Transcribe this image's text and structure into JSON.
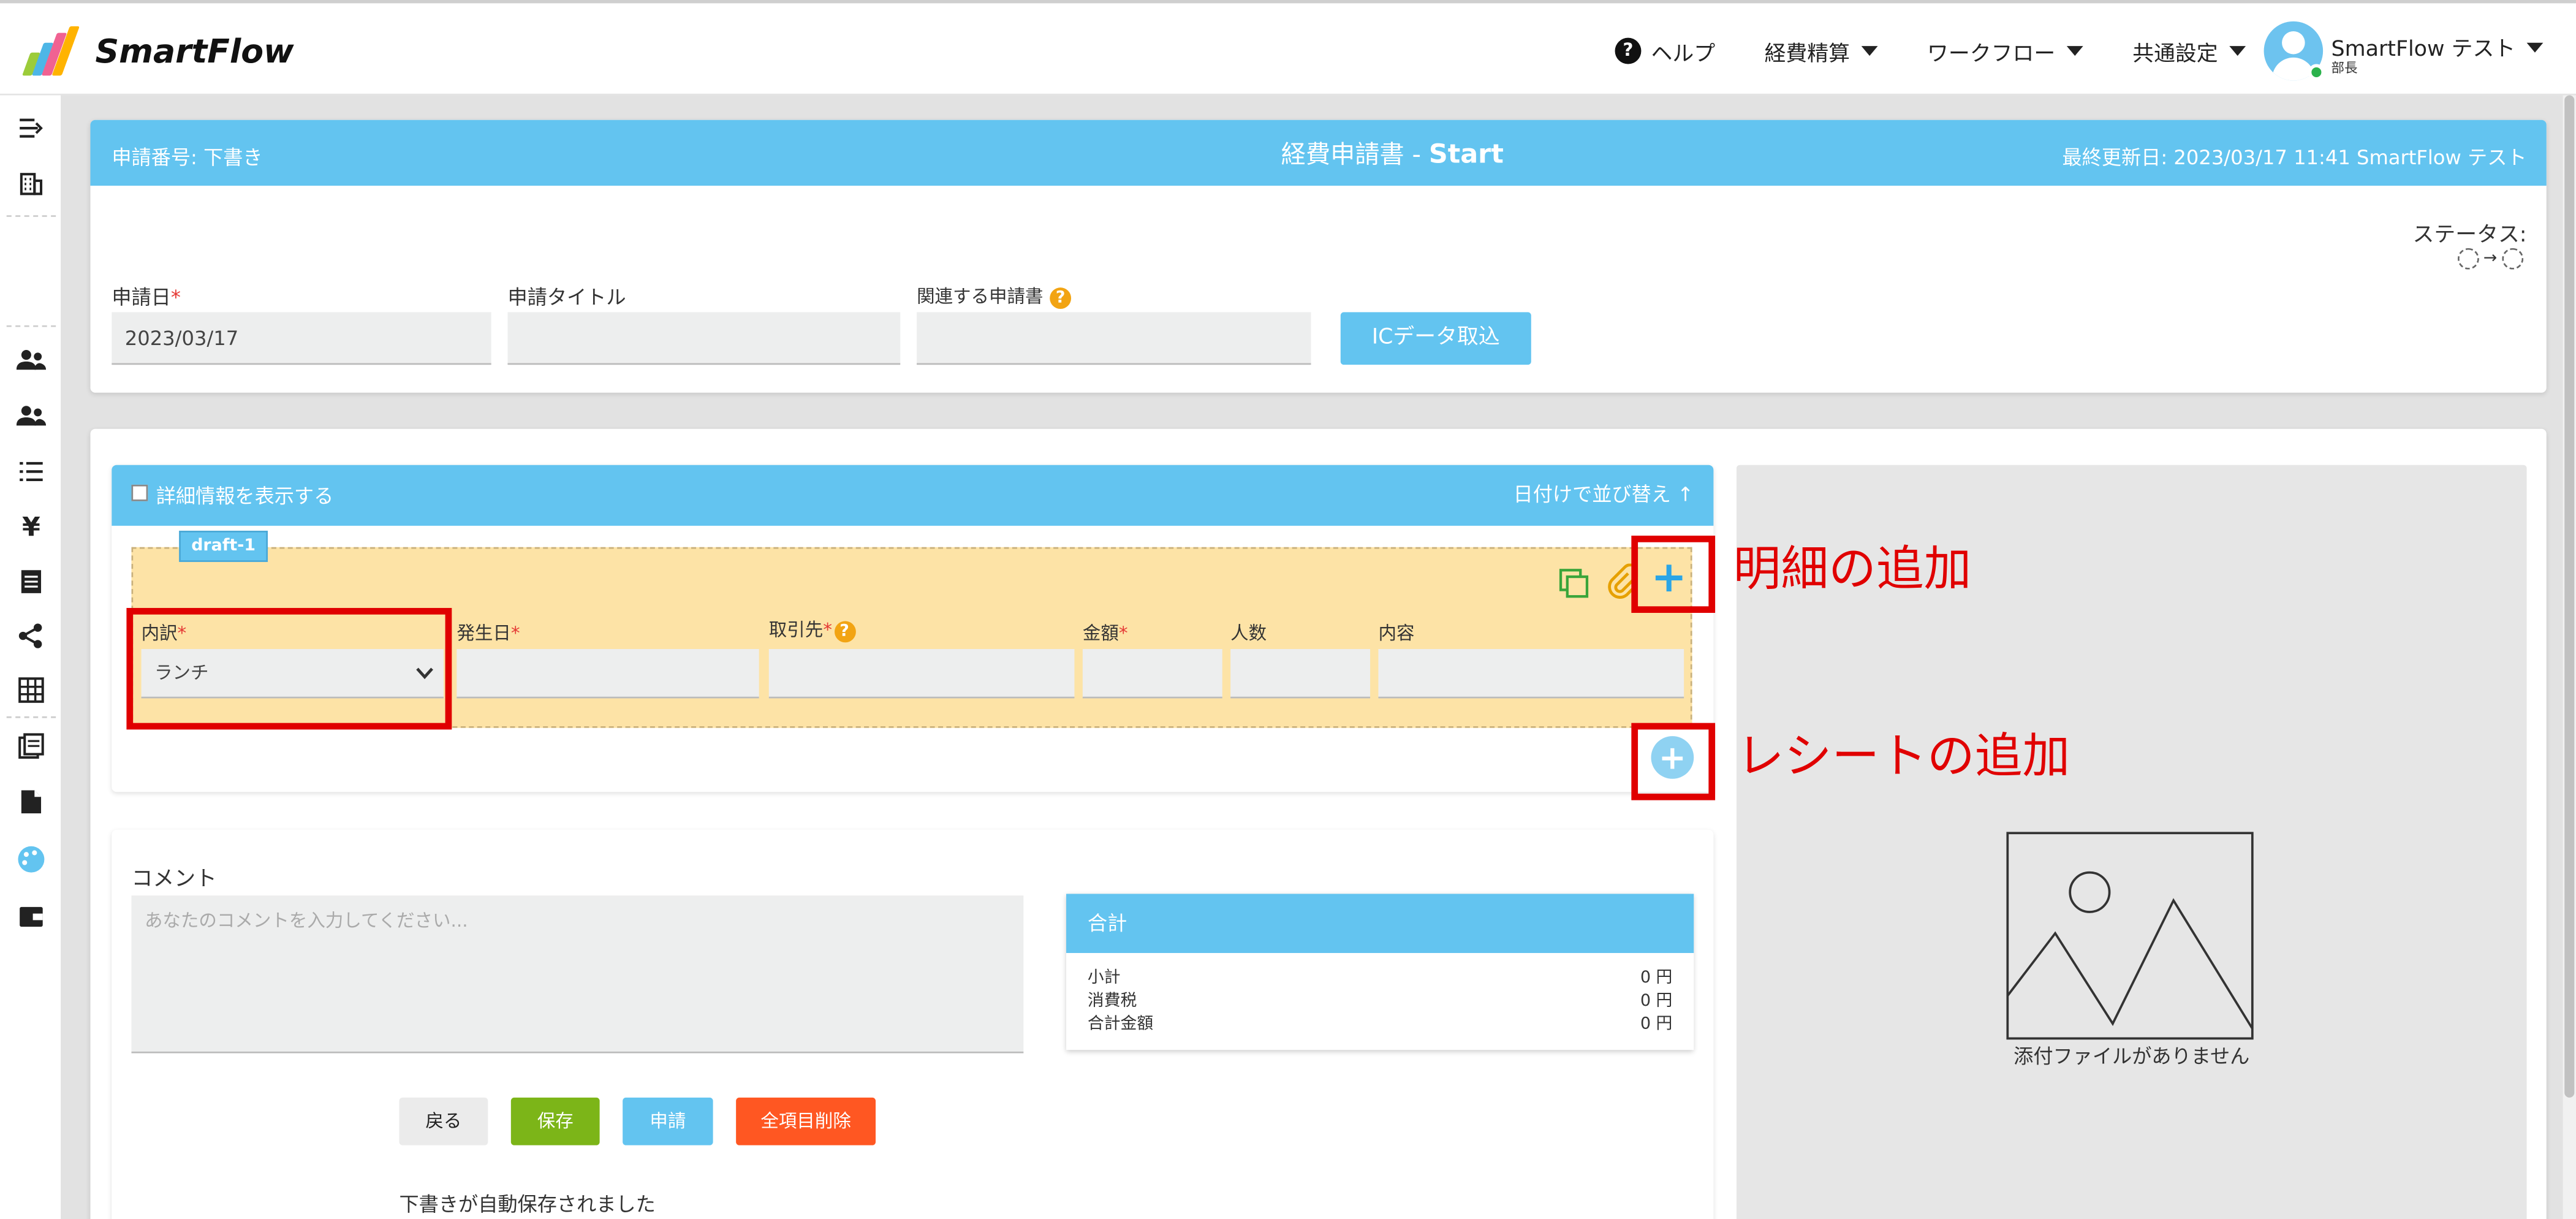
{
  "header": {
    "brand": "SmartFlow",
    "help_label": "ヘルプ",
    "menus": [
      "経費精算",
      "ワークフロー",
      "共通設定"
    ],
    "user_name": "SmartFlow テスト",
    "user_role": "部長"
  },
  "form": {
    "number_label": "申請番号: 下書き",
    "title_prefix": "経費申請書 - ",
    "title_strong": "Start",
    "last_updated": "最終更新日: 2023/03/17 11:41 SmartFlow テスト",
    "status_label": "ステータス:",
    "date_label": "申請日",
    "date_value": "2023/03/17",
    "title_label": "申請タイトル",
    "related_label": "関連する申請書",
    "ic_button": "ICデータ取込",
    "required_mark": "*",
    "q_mark": "?"
  },
  "details": {
    "show_detail_label": "詳細情報を表示する",
    "sort_label": "日付けで並び替え",
    "sort_arrow": "↑",
    "draft_tag": "draft-1",
    "columns": {
      "breakdown": "内訳",
      "date": "発生日",
      "vendor": "取引先",
      "amount": "金額",
      "people": "人数",
      "content": "内容"
    },
    "breakdown_value": "ランチ",
    "plus_glyph": "+"
  },
  "comment": {
    "label": "コメント",
    "placeholder": "あなたのコメントを入力してください..."
  },
  "totals": {
    "header": "合計",
    "rows": [
      {
        "label": "小計",
        "value": "0 円"
      },
      {
        "label": "消費税",
        "value": "0 円"
      },
      {
        "label": "合計金額",
        "value": "0 円"
      }
    ]
  },
  "actions": {
    "back": "戻る",
    "save": "保存",
    "apply": "申請",
    "clear_all": "全項目削除",
    "autosave_msg": "下書きが自動保存されました"
  },
  "attachment": {
    "no_file": "添付ファイルがありません"
  },
  "annotations": {
    "add_detail": "明細の追加",
    "add_receipt": "レシートの追加"
  },
  "colors": {
    "accent": "#63c4f0",
    "row_bg": "#fde3a6",
    "save": "#7cb518",
    "clear": "#ff5722",
    "annotation": "#e00000"
  }
}
